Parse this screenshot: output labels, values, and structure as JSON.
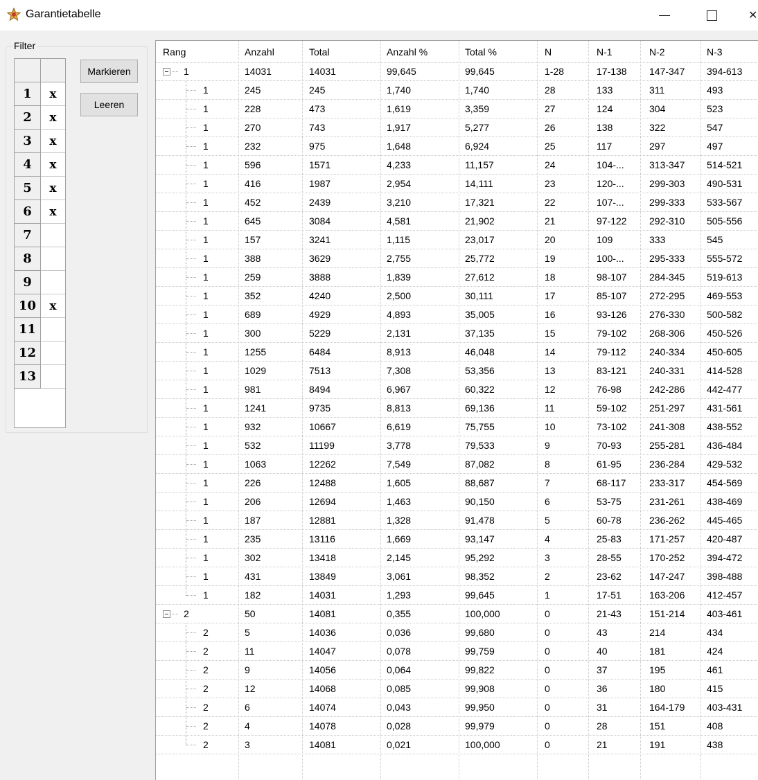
{
  "window": {
    "title": "Garantietabelle"
  },
  "filter": {
    "legend": "Filter",
    "rows": [
      {
        "num": "1",
        "val": "x"
      },
      {
        "num": "2",
        "val": "x"
      },
      {
        "num": "3",
        "val": "x"
      },
      {
        "num": "4",
        "val": "x"
      },
      {
        "num": "5",
        "val": "x"
      },
      {
        "num": "6",
        "val": "x"
      },
      {
        "num": "7",
        "val": ""
      },
      {
        "num": "8",
        "val": ""
      },
      {
        "num": "9",
        "val": ""
      },
      {
        "num": "10",
        "val": "x"
      },
      {
        "num": "11",
        "val": ""
      },
      {
        "num": "12",
        "val": ""
      },
      {
        "num": "13",
        "val": ""
      }
    ]
  },
  "buttons": {
    "mark": "Markieren",
    "clear": "Leeren"
  },
  "table": {
    "columns": [
      "Rang",
      "Anzahl",
      "Total",
      "Anzahl %",
      "Total %",
      "N",
      "N-1",
      "N-2",
      "N-3"
    ],
    "rows": [
      {
        "level": 0,
        "rang": "1",
        "cells": [
          "14031",
          "14031",
          "99,645",
          "99,645",
          "1-28",
          "17-138",
          "147-347",
          "394-613"
        ]
      },
      {
        "level": 1,
        "rang": "1",
        "cells": [
          "245",
          "245",
          "1,740",
          "1,740",
          "28",
          "133",
          "311",
          "493"
        ]
      },
      {
        "level": 1,
        "rang": "1",
        "cells": [
          "228",
          "473",
          "1,619",
          "3,359",
          "27",
          "124",
          "304",
          "523"
        ]
      },
      {
        "level": 1,
        "rang": "1",
        "cells": [
          "270",
          "743",
          "1,917",
          "5,277",
          "26",
          "138",
          "322",
          "547"
        ]
      },
      {
        "level": 1,
        "rang": "1",
        "cells": [
          "232",
          "975",
          "1,648",
          "6,924",
          "25",
          "117",
          "297",
          "497"
        ]
      },
      {
        "level": 1,
        "rang": "1",
        "cells": [
          "596",
          "1571",
          "4,233",
          "11,157",
          "24",
          "104-...",
          "313-347",
          "514-521"
        ]
      },
      {
        "level": 1,
        "rang": "1",
        "cells": [
          "416",
          "1987",
          "2,954",
          "14,111",
          "23",
          "120-...",
          "299-303",
          "490-531"
        ]
      },
      {
        "level": 1,
        "rang": "1",
        "cells": [
          "452",
          "2439",
          "3,210",
          "17,321",
          "22",
          "107-...",
          "299-333",
          "533-567"
        ]
      },
      {
        "level": 1,
        "rang": "1",
        "cells": [
          "645",
          "3084",
          "4,581",
          "21,902",
          "21",
          "97-122",
          "292-310",
          "505-556"
        ]
      },
      {
        "level": 1,
        "rang": "1",
        "cells": [
          "157",
          "3241",
          "1,115",
          "23,017",
          "20",
          "109",
          "333",
          "545"
        ]
      },
      {
        "level": 1,
        "rang": "1",
        "cells": [
          "388",
          "3629",
          "2,755",
          "25,772",
          "19",
          "100-...",
          "295-333",
          "555-572"
        ]
      },
      {
        "level": 1,
        "rang": "1",
        "cells": [
          "259",
          "3888",
          "1,839",
          "27,612",
          "18",
          "98-107",
          "284-345",
          "519-613"
        ]
      },
      {
        "level": 1,
        "rang": "1",
        "cells": [
          "352",
          "4240",
          "2,500",
          "30,111",
          "17",
          "85-107",
          "272-295",
          "469-553"
        ]
      },
      {
        "level": 1,
        "rang": "1",
        "cells": [
          "689",
          "4929",
          "4,893",
          "35,005",
          "16",
          "93-126",
          "276-330",
          "500-582"
        ]
      },
      {
        "level": 1,
        "rang": "1",
        "cells": [
          "300",
          "5229",
          "2,131",
          "37,135",
          "15",
          "79-102",
          "268-306",
          "450-526"
        ]
      },
      {
        "level": 1,
        "rang": "1",
        "cells": [
          "1255",
          "6484",
          "8,913",
          "46,048",
          "14",
          "79-112",
          "240-334",
          "450-605"
        ]
      },
      {
        "level": 1,
        "rang": "1",
        "cells": [
          "1029",
          "7513",
          "7,308",
          "53,356",
          "13",
          "83-121",
          "240-331",
          "414-528"
        ]
      },
      {
        "level": 1,
        "rang": "1",
        "cells": [
          "981",
          "8494",
          "6,967",
          "60,322",
          "12",
          "76-98",
          "242-286",
          "442-477"
        ]
      },
      {
        "level": 1,
        "rang": "1",
        "cells": [
          "1241",
          "9735",
          "8,813",
          "69,136",
          "11",
          "59-102",
          "251-297",
          "431-561"
        ]
      },
      {
        "level": 1,
        "rang": "1",
        "cells": [
          "932",
          "10667",
          "6,619",
          "75,755",
          "10",
          "73-102",
          "241-308",
          "438-552"
        ]
      },
      {
        "level": 1,
        "rang": "1",
        "cells": [
          "532",
          "11199",
          "3,778",
          "79,533",
          "9",
          "70-93",
          "255-281",
          "436-484"
        ]
      },
      {
        "level": 1,
        "rang": "1",
        "cells": [
          "1063",
          "12262",
          "7,549",
          "87,082",
          "8",
          "61-95",
          "236-284",
          "429-532"
        ]
      },
      {
        "level": 1,
        "rang": "1",
        "cells": [
          "226",
          "12488",
          "1,605",
          "88,687",
          "7",
          "68-117",
          "233-317",
          "454-569"
        ]
      },
      {
        "level": 1,
        "rang": "1",
        "cells": [
          "206",
          "12694",
          "1,463",
          "90,150",
          "6",
          "53-75",
          "231-261",
          "438-469"
        ]
      },
      {
        "level": 1,
        "rang": "1",
        "cells": [
          "187",
          "12881",
          "1,328",
          "91,478",
          "5",
          "60-78",
          "236-262",
          "445-465"
        ]
      },
      {
        "level": 1,
        "rang": "1",
        "cells": [
          "235",
          "13116",
          "1,669",
          "93,147",
          "4",
          "25-83",
          "171-257",
          "420-487"
        ]
      },
      {
        "level": 1,
        "rang": "1",
        "cells": [
          "302",
          "13418",
          "2,145",
          "95,292",
          "3",
          "28-55",
          "170-252",
          "394-472"
        ]
      },
      {
        "level": 1,
        "rang": "1",
        "cells": [
          "431",
          "13849",
          "3,061",
          "98,352",
          "2",
          "23-62",
          "147-247",
          "398-488"
        ]
      },
      {
        "level": 1,
        "rang": "1",
        "cells": [
          "182",
          "14031",
          "1,293",
          "99,645",
          "1",
          "17-51",
          "163-206",
          "412-457"
        ]
      },
      {
        "level": 0,
        "rang": "2",
        "cells": [
          "50",
          "14081",
          "0,355",
          "100,000",
          "0",
          "21-43",
          "151-214",
          "403-461"
        ]
      },
      {
        "level": 1,
        "rang": "2",
        "cells": [
          "5",
          "14036",
          "0,036",
          "99,680",
          "0",
          "43",
          "214",
          "434"
        ]
      },
      {
        "level": 1,
        "rang": "2",
        "cells": [
          "11",
          "14047",
          "0,078",
          "99,759",
          "0",
          "40",
          "181",
          "424"
        ]
      },
      {
        "level": 1,
        "rang": "2",
        "cells": [
          "9",
          "14056",
          "0,064",
          "99,822",
          "0",
          "37",
          "195",
          "461"
        ]
      },
      {
        "level": 1,
        "rang": "2",
        "cells": [
          "12",
          "14068",
          "0,085",
          "99,908",
          "0",
          "36",
          "180",
          "415"
        ]
      },
      {
        "level": 1,
        "rang": "2",
        "cells": [
          "6",
          "14074",
          "0,043",
          "99,950",
          "0",
          "31",
          "164-179",
          "403-431"
        ]
      },
      {
        "level": 1,
        "rang": "2",
        "cells": [
          "4",
          "14078",
          "0,028",
          "99,979",
          "0",
          "28",
          "151",
          "408"
        ]
      },
      {
        "level": 1,
        "rang": "2",
        "cells": [
          "3",
          "14081",
          "0,021",
          "100,000",
          "0",
          "21",
          "191",
          "438"
        ]
      }
    ]
  }
}
